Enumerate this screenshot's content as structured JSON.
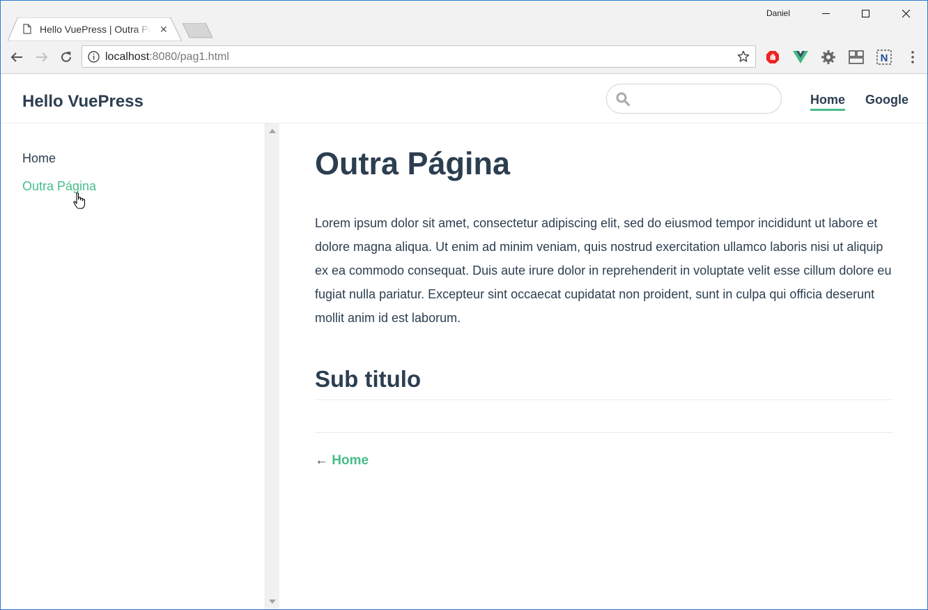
{
  "browser": {
    "tab_title": "Hello VuePress | Outra Página",
    "user_name": "Daniel",
    "url_host": "localhost",
    "url_path": ":8080/pag1.html"
  },
  "site": {
    "name": "Hello VuePress",
    "search_placeholder": "",
    "nav": [
      {
        "label": "Home",
        "active": true
      },
      {
        "label": "Google",
        "active": false
      }
    ]
  },
  "sidebar": {
    "items": [
      {
        "label": "Home",
        "active": false
      },
      {
        "label": "Outra Página",
        "active": true
      }
    ]
  },
  "content": {
    "title": "Outra Página",
    "paragraph": "Lorem ipsum dolor sit amet, consectetur adipiscing elit, sed do eiusmod tempor incididunt ut labore et dolore magna aliqua. Ut enim ad minim veniam, quis nostrud exercitation ullamco laboris nisi ut aliquip ex ea commodo consequat. Duis aute irure dolor in reprehenderit in voluptate velit esse cillum dolore eu fugiat nulla pariatur. Excepteur sint occaecat cupidatat non proident, sunt in culpa qui officia deserunt mollit anim id est laborum.",
    "subtitle": "Sub titulo",
    "prev_arrow": "←",
    "prev_label": "Home"
  },
  "colors": {
    "accent": "#46bd87",
    "text": "#2c3e50",
    "window_border": "#2b79d0"
  },
  "icons": {
    "tab": "page-icon",
    "tab_close": "close-icon",
    "back": "back-arrow-icon",
    "forward": "forward-arrow-icon",
    "reload": "reload-icon",
    "info": "info-icon",
    "bookmark": "star-icon",
    "extensions": [
      "adblock-icon",
      "vue-devtools-icon",
      "gear-extension-icon",
      "layout-extension-icon",
      "n-extension-icon"
    ],
    "menu": "kebab-menu-icon",
    "search": "search-icon",
    "cursor": "hand-cursor-icon"
  }
}
